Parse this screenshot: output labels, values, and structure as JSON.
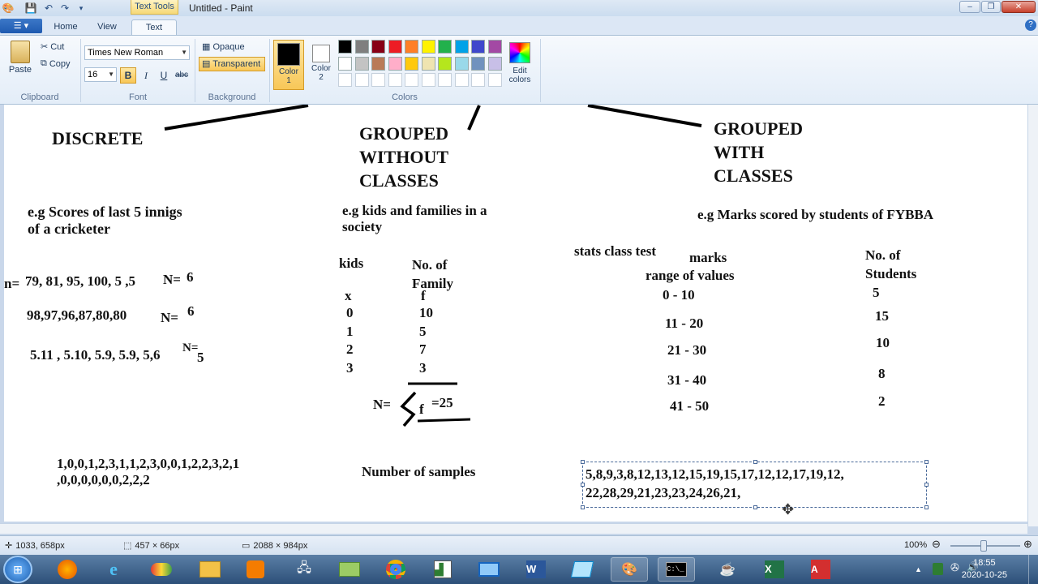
{
  "window": {
    "title": "Untitled - Paint",
    "context_tab": "Text Tools",
    "controls": [
      "–",
      "❐",
      "✕"
    ]
  },
  "tabs": [
    {
      "label": "Home"
    },
    {
      "label": "View"
    },
    {
      "label": "Text"
    }
  ],
  "ribbon": {
    "clipboard": {
      "paste": "Paste",
      "cut": "Cut",
      "copy": "Copy",
      "group": "Clipboard"
    },
    "font": {
      "family": "Times New Roman",
      "size": "16",
      "bold": "B",
      "italic": "I",
      "underline": "U",
      "strike": "abc",
      "group": "Font"
    },
    "background": {
      "opaque": "Opaque",
      "transparent": "Transparent",
      "group": "Background"
    },
    "colors": {
      "color1_label": "Color\n1",
      "color2_label": "Color\n2",
      "edit_label": "Edit\ncolors",
      "group": "Colors",
      "color1": "#000000",
      "color2": "#ffffff",
      "palette_row1": [
        "#000000",
        "#7f7f7f",
        "#880015",
        "#ed1c24",
        "#ff7f27",
        "#fff200",
        "#22b14c",
        "#00a2e8",
        "#3f48cc",
        "#a349a4"
      ],
      "palette_row2": [
        "#ffffff",
        "#c3c3c3",
        "#b97a57",
        "#ffaec9",
        "#ffc90e",
        "#efe4b0",
        "#b5e61d",
        "#99d9ea",
        "#7092be",
        "#c8bfe7"
      ]
    }
  },
  "canvas": {
    "col1": {
      "heading": "DISCRETE",
      "example": "e.g Scores of last 5 innigs\nof a cricketer",
      "n_label": "n=",
      "row1": "79, 81, 95, 100, 5 ,5",
      "row1_n": "N=",
      "row1_v": "6",
      "row2": "98,97,96,87,80,80",
      "row2_n": "N=",
      "row2_v": "6",
      "row3": "5.11 , 5.10, 5.9, 5.9, 5,6",
      "row3_n": "N=",
      "row3_v": "5",
      "bottom": "1,0,0,1,2,3,1,1,2,3,0,0,1,2,2,3,2,1\n,0,0,0,0,0,0,2,2,2"
    },
    "col2": {
      "heading": "GROUPED\nWITHOUT\nCLASSES",
      "example": "e.g kids and families in a\nsociety",
      "col_kids": "kids",
      "col_family": "No. of\nFamily",
      "var_x": "x",
      "var_f": "f",
      "x_values": [
        "0",
        "1",
        "2",
        "3"
      ],
      "f_values": [
        "10",
        "5",
        "7",
        "3"
      ],
      "sum_label": "N=",
      "sum_f": "f",
      "sum_value": "=25",
      "bottom": "Number of samples"
    },
    "col3": {
      "heading": "GROUPED\nWITH\nCLASSES",
      "example": "e.g Marks scored by students of FYBBA",
      "stats": "stats class test",
      "marks": "marks",
      "range": "range of values",
      "students": "No. of\nStudents",
      "ranges": [
        "0 - 10",
        "11 - 20",
        "21 - 30",
        "31 - 40",
        "41 - 50"
      ],
      "counts": [
        "5",
        "15",
        "10",
        "8",
        "2"
      ],
      "textbox": "5,8,9,3,8,12,13,12,15,19,15,17,12,12,17,19,12,\n22,28,29,21,23,23,24,26,21,"
    }
  },
  "status": {
    "cursor": "1033, 658px",
    "selection": "457 × 66px",
    "image_size": "2088 × 984px",
    "zoom": "100%"
  },
  "taskbar": {
    "time": "18:55",
    "date": "2020-10-25"
  }
}
